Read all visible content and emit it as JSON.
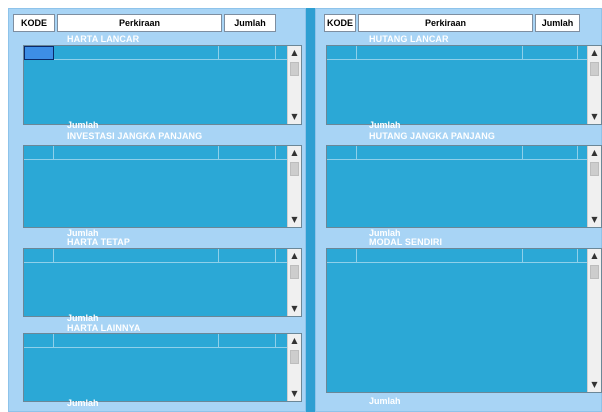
{
  "left": {
    "headers": {
      "kode": "KODE",
      "perkiraan": "Perkiraan",
      "jumlah": "Jumlah"
    },
    "sections": [
      {
        "title": "HARTA LANCAR",
        "total_label": "Jumlah"
      },
      {
        "title": "INVESTASI JANGKA PANJANG",
        "total_label": "Jumlah"
      },
      {
        "title": "HARTA TETAP",
        "total_label": "Jumlah"
      },
      {
        "title": "HARTA LAINNYA",
        "total_label": "Jumlah"
      }
    ]
  },
  "right": {
    "headers": {
      "kode": "KODE",
      "perkiraan": "Perkiraan",
      "jumlah": "Jumlah"
    },
    "sections": [
      {
        "title": "HUTANG LANCAR",
        "total_label": "Jumlah"
      },
      {
        "title": "HUTANG JANGKA PANJANG",
        "total_label": "Jumlah"
      },
      {
        "title": "MODAL SENDIRI",
        "total_label": "Jumlah"
      }
    ]
  },
  "icons": {
    "scroll_up": "▲",
    "scroll_down": "▼"
  },
  "colors": {
    "panel": "#a8d4f5",
    "grid": "#2ba8d6",
    "selected_cell": "#3d8ee6"
  }
}
